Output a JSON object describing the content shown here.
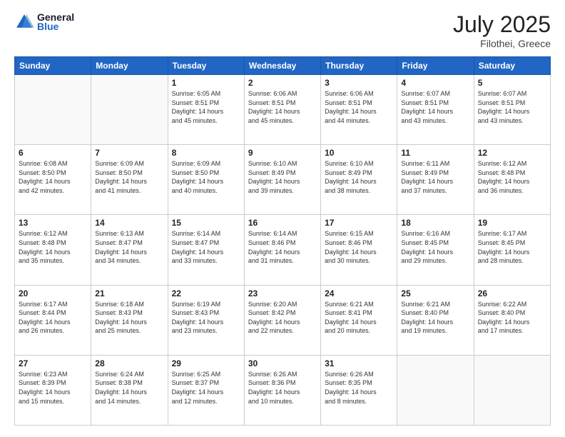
{
  "header": {
    "logo_general": "General",
    "logo_blue": "Blue",
    "month_year": "July 2025",
    "location": "Filothei, Greece"
  },
  "weekdays": [
    "Sunday",
    "Monday",
    "Tuesday",
    "Wednesday",
    "Thursday",
    "Friday",
    "Saturday"
  ],
  "weeks": [
    [
      {
        "day": "",
        "info": ""
      },
      {
        "day": "",
        "info": ""
      },
      {
        "day": "1",
        "info": "Sunrise: 6:05 AM\nSunset: 8:51 PM\nDaylight: 14 hours\nand 45 minutes."
      },
      {
        "day": "2",
        "info": "Sunrise: 6:06 AM\nSunset: 8:51 PM\nDaylight: 14 hours\nand 45 minutes."
      },
      {
        "day": "3",
        "info": "Sunrise: 6:06 AM\nSunset: 8:51 PM\nDaylight: 14 hours\nand 44 minutes."
      },
      {
        "day": "4",
        "info": "Sunrise: 6:07 AM\nSunset: 8:51 PM\nDaylight: 14 hours\nand 43 minutes."
      },
      {
        "day": "5",
        "info": "Sunrise: 6:07 AM\nSunset: 8:51 PM\nDaylight: 14 hours\nand 43 minutes."
      }
    ],
    [
      {
        "day": "6",
        "info": "Sunrise: 6:08 AM\nSunset: 8:50 PM\nDaylight: 14 hours\nand 42 minutes."
      },
      {
        "day": "7",
        "info": "Sunrise: 6:09 AM\nSunset: 8:50 PM\nDaylight: 14 hours\nand 41 minutes."
      },
      {
        "day": "8",
        "info": "Sunrise: 6:09 AM\nSunset: 8:50 PM\nDaylight: 14 hours\nand 40 minutes."
      },
      {
        "day": "9",
        "info": "Sunrise: 6:10 AM\nSunset: 8:49 PM\nDaylight: 14 hours\nand 39 minutes."
      },
      {
        "day": "10",
        "info": "Sunrise: 6:10 AM\nSunset: 8:49 PM\nDaylight: 14 hours\nand 38 minutes."
      },
      {
        "day": "11",
        "info": "Sunrise: 6:11 AM\nSunset: 8:49 PM\nDaylight: 14 hours\nand 37 minutes."
      },
      {
        "day": "12",
        "info": "Sunrise: 6:12 AM\nSunset: 8:48 PM\nDaylight: 14 hours\nand 36 minutes."
      }
    ],
    [
      {
        "day": "13",
        "info": "Sunrise: 6:12 AM\nSunset: 8:48 PM\nDaylight: 14 hours\nand 35 minutes."
      },
      {
        "day": "14",
        "info": "Sunrise: 6:13 AM\nSunset: 8:47 PM\nDaylight: 14 hours\nand 34 minutes."
      },
      {
        "day": "15",
        "info": "Sunrise: 6:14 AM\nSunset: 8:47 PM\nDaylight: 14 hours\nand 33 minutes."
      },
      {
        "day": "16",
        "info": "Sunrise: 6:14 AM\nSunset: 8:46 PM\nDaylight: 14 hours\nand 31 minutes."
      },
      {
        "day": "17",
        "info": "Sunrise: 6:15 AM\nSunset: 8:46 PM\nDaylight: 14 hours\nand 30 minutes."
      },
      {
        "day": "18",
        "info": "Sunrise: 6:16 AM\nSunset: 8:45 PM\nDaylight: 14 hours\nand 29 minutes."
      },
      {
        "day": "19",
        "info": "Sunrise: 6:17 AM\nSunset: 8:45 PM\nDaylight: 14 hours\nand 28 minutes."
      }
    ],
    [
      {
        "day": "20",
        "info": "Sunrise: 6:17 AM\nSunset: 8:44 PM\nDaylight: 14 hours\nand 26 minutes."
      },
      {
        "day": "21",
        "info": "Sunrise: 6:18 AM\nSunset: 8:43 PM\nDaylight: 14 hours\nand 25 minutes."
      },
      {
        "day": "22",
        "info": "Sunrise: 6:19 AM\nSunset: 8:43 PM\nDaylight: 14 hours\nand 23 minutes."
      },
      {
        "day": "23",
        "info": "Sunrise: 6:20 AM\nSunset: 8:42 PM\nDaylight: 14 hours\nand 22 minutes."
      },
      {
        "day": "24",
        "info": "Sunrise: 6:21 AM\nSunset: 8:41 PM\nDaylight: 14 hours\nand 20 minutes."
      },
      {
        "day": "25",
        "info": "Sunrise: 6:21 AM\nSunset: 8:40 PM\nDaylight: 14 hours\nand 19 minutes."
      },
      {
        "day": "26",
        "info": "Sunrise: 6:22 AM\nSunset: 8:40 PM\nDaylight: 14 hours\nand 17 minutes."
      }
    ],
    [
      {
        "day": "27",
        "info": "Sunrise: 6:23 AM\nSunset: 8:39 PM\nDaylight: 14 hours\nand 15 minutes."
      },
      {
        "day": "28",
        "info": "Sunrise: 6:24 AM\nSunset: 8:38 PM\nDaylight: 14 hours\nand 14 minutes."
      },
      {
        "day": "29",
        "info": "Sunrise: 6:25 AM\nSunset: 8:37 PM\nDaylight: 14 hours\nand 12 minutes."
      },
      {
        "day": "30",
        "info": "Sunrise: 6:26 AM\nSunset: 8:36 PM\nDaylight: 14 hours\nand 10 minutes."
      },
      {
        "day": "31",
        "info": "Sunrise: 6:26 AM\nSunset: 8:35 PM\nDaylight: 14 hours\nand 8 minutes."
      },
      {
        "day": "",
        "info": ""
      },
      {
        "day": "",
        "info": ""
      }
    ]
  ]
}
